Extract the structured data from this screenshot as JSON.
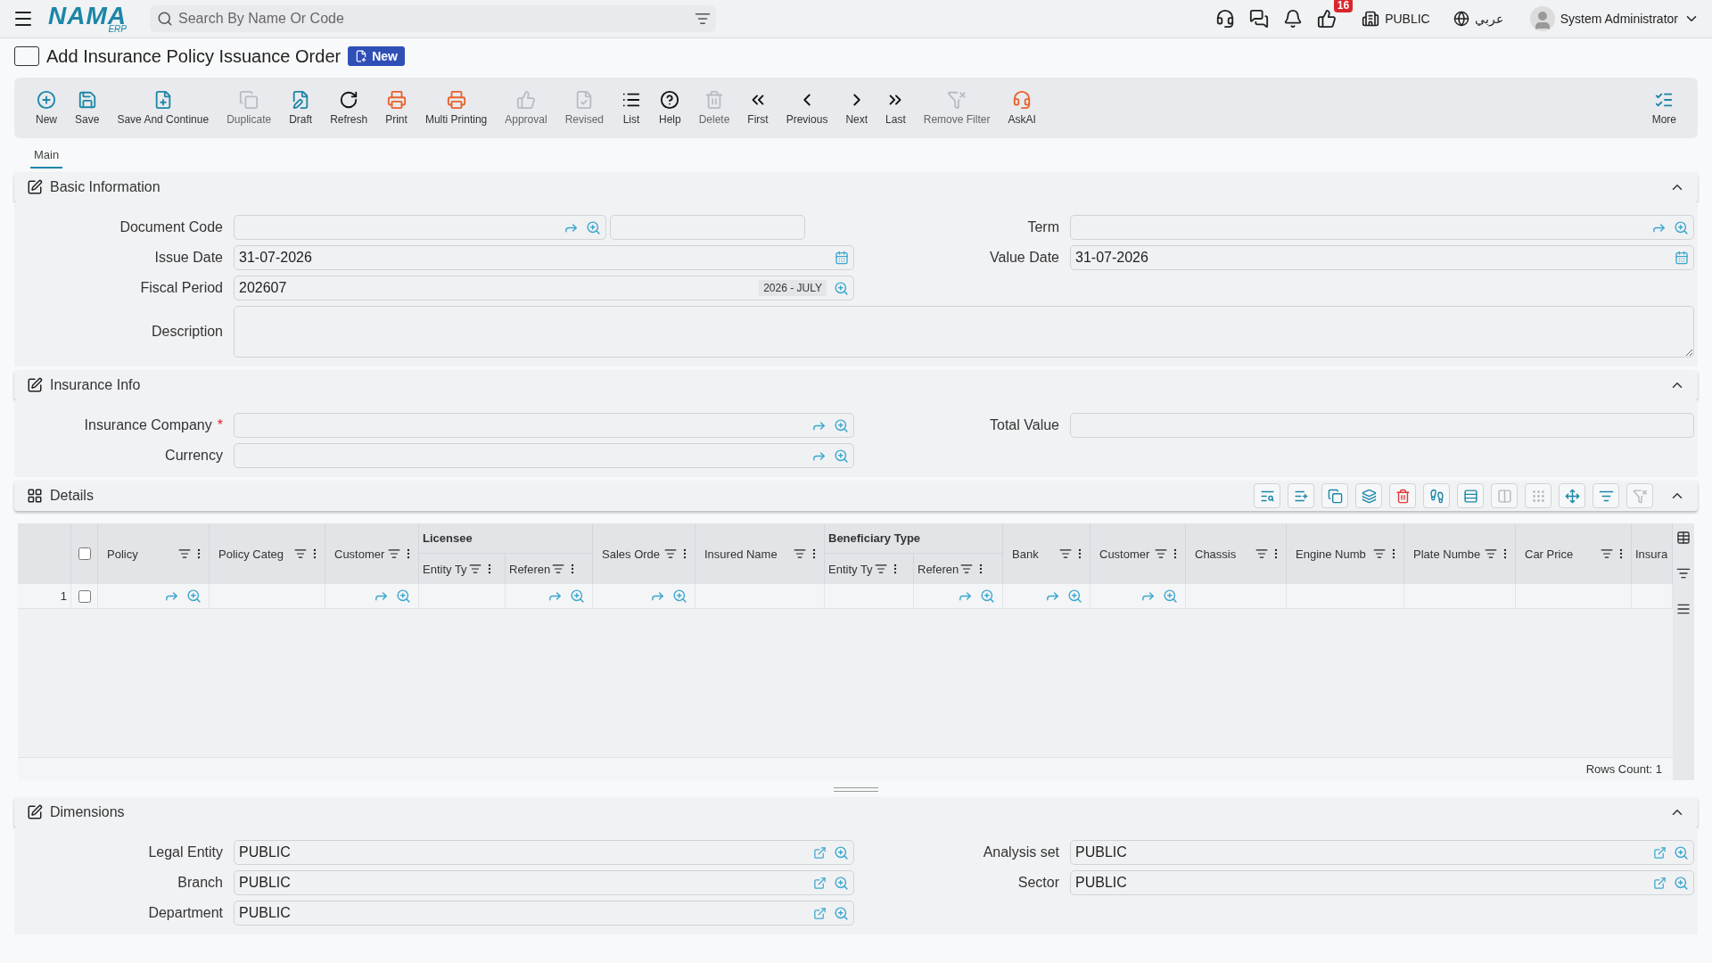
{
  "topbar": {
    "logo": "NAMA",
    "logo_sub": "ERP",
    "search": {
      "placeholder": "Search By Name Or Code"
    },
    "badge": "16",
    "company": "PUBLIC",
    "language": "عربي",
    "user": "System Administrator"
  },
  "page": {
    "title": "Add Insurance Policy Issuance Order",
    "status": "New"
  },
  "toolbar": [
    {
      "kind": "new",
      "label": "New",
      "disabled": false
    },
    {
      "kind": "save",
      "label": "Save",
      "disabled": false
    },
    {
      "kind": "save-continue",
      "label": "Save And Continue",
      "disabled": false
    },
    {
      "kind": "duplicate",
      "label": "Duplicate",
      "disabled": true
    },
    {
      "kind": "draft",
      "label": "Draft",
      "disabled": false
    },
    {
      "kind": "refresh",
      "label": "Refresh",
      "disabled": false
    },
    {
      "kind": "print",
      "label": "Print",
      "disabled": false
    },
    {
      "kind": "multi-print",
      "label": "Multi Printing",
      "disabled": false
    },
    {
      "kind": "approval",
      "label": "Approval",
      "disabled": true
    },
    {
      "kind": "revised",
      "label": "Revised",
      "disabled": true
    },
    {
      "kind": "list",
      "label": "List",
      "disabled": false
    },
    {
      "kind": "help",
      "label": "Help",
      "disabled": false
    },
    {
      "kind": "delete",
      "label": "Delete",
      "disabled": true
    },
    {
      "kind": "first",
      "label": "First",
      "disabled": false
    },
    {
      "kind": "previous",
      "label": "Previous",
      "disabled": false
    },
    {
      "kind": "next",
      "label": "Next",
      "disabled": false
    },
    {
      "kind": "last",
      "label": "Last",
      "disabled": false
    },
    {
      "kind": "remove-filter",
      "label": "Remove Filter",
      "disabled": true
    },
    {
      "kind": "ask-ai",
      "label": "AskAI",
      "disabled": false
    }
  ],
  "more": {
    "label": "More"
  },
  "tabs": [
    {
      "label": "Main",
      "selected": true
    }
  ],
  "basic": {
    "title": "Basic Information",
    "expanded": true,
    "rows": [
      [
        {
          "kind": "lookup-extra",
          "label": "Document Code"
        },
        {
          "kind": "lookup",
          "label": "Term"
        }
      ],
      [
        {
          "kind": "date",
          "label": "Issue Date",
          "value": "31-07-2026"
        },
        {
          "kind": "date",
          "label": "Value Date",
          "value": "31-07-2026"
        }
      ],
      [
        {
          "kind": "period",
          "label": "Fiscal Period",
          "value": "202607",
          "suffix": "2026 - JULY"
        }
      ],
      [
        {
          "kind": "textarea",
          "label": "Description"
        }
      ]
    ]
  },
  "insurance": {
    "title": "Insurance Info",
    "expanded": true,
    "rows": [
      [
        {
          "kind": "lookup",
          "label": "Insurance Company",
          "required_mark": "*"
        },
        {
          "kind": "text",
          "label": "Total Value"
        }
      ],
      [
        {
          "kind": "lookup",
          "label": "Currency"
        }
      ]
    ]
  },
  "details": {
    "title": "Details",
    "expanded": true,
    "tools": [
      {
        "kind": "search-list",
        "disabled": false
      },
      {
        "kind": "add-row",
        "disabled": false
      },
      {
        "kind": "copy",
        "disabled": false
      },
      {
        "kind": "layers",
        "disabled": false
      },
      {
        "kind": "delete",
        "disabled": false
      },
      {
        "kind": "run",
        "disabled": false
      },
      {
        "kind": "rows",
        "disabled": false
      },
      {
        "kind": "resize",
        "disabled": true
      },
      {
        "kind": "dots",
        "disabled": true
      },
      {
        "kind": "move",
        "disabled": false
      },
      {
        "kind": "filter",
        "disabled": false
      },
      {
        "kind": "filter-off",
        "disabled": true
      }
    ],
    "all_checked": false,
    "columns": [
      {
        "kind": "column",
        "label": "Policy",
        "lookup": true
      },
      {
        "kind": "column",
        "label": "Policy Categ",
        "lookup": false
      },
      {
        "kind": "column",
        "label": "Customer",
        "lookup": true
      },
      {
        "kind": "group",
        "label": "Licensee",
        "children": [
          {
            "label": "Entity Ty",
            "lookup": false
          },
          {
            "label": "Referen",
            "lookup": true
          }
        ]
      },
      {
        "kind": "column",
        "label": "Sales Orde",
        "lookup": true
      },
      {
        "kind": "column",
        "label": "Insured Name",
        "lookup": false
      },
      {
        "kind": "group",
        "label": "Beneficiary Type",
        "children": [
          {
            "label": "Entity Ty",
            "lookup": false
          },
          {
            "label": "Referen",
            "lookup": true
          }
        ]
      },
      {
        "kind": "column",
        "label": "Bank",
        "lookup": true
      },
      {
        "kind": "column",
        "label": "Customer",
        "lookup": true
      },
      {
        "kind": "column",
        "label": "Chassis",
        "lookup": false
      },
      {
        "kind": "column",
        "label": "Engine Numb",
        "lookup": false
      },
      {
        "kind": "column",
        "label": "Plate Numbe",
        "lookup": false
      },
      {
        "kind": "column",
        "label": "Car Price",
        "lookup": false
      },
      {
        "kind": "column",
        "label": "Insura",
        "lookup": false
      }
    ],
    "rows": [
      {
        "number": "1",
        "checked": false
      }
    ],
    "rows_count": "Rows Count: 1"
  },
  "dimensions": {
    "title": "Dimensions",
    "expanded": true,
    "rows": [
      [
        {
          "kind": "dimension",
          "label": "Legal Entity",
          "value": "PUBLIC"
        },
        {
          "kind": "dimension",
          "label": "Analysis set",
          "value": "PUBLIC"
        }
      ],
      [
        {
          "kind": "dimension",
          "label": "Branch",
          "value": "PUBLIC"
        },
        {
          "kind": "dimension",
          "label": "Sector",
          "value": "PUBLIC"
        }
      ],
      [
        {
          "kind": "dimension",
          "label": "Department",
          "value": "PUBLIC"
        }
      ]
    ]
  }
}
